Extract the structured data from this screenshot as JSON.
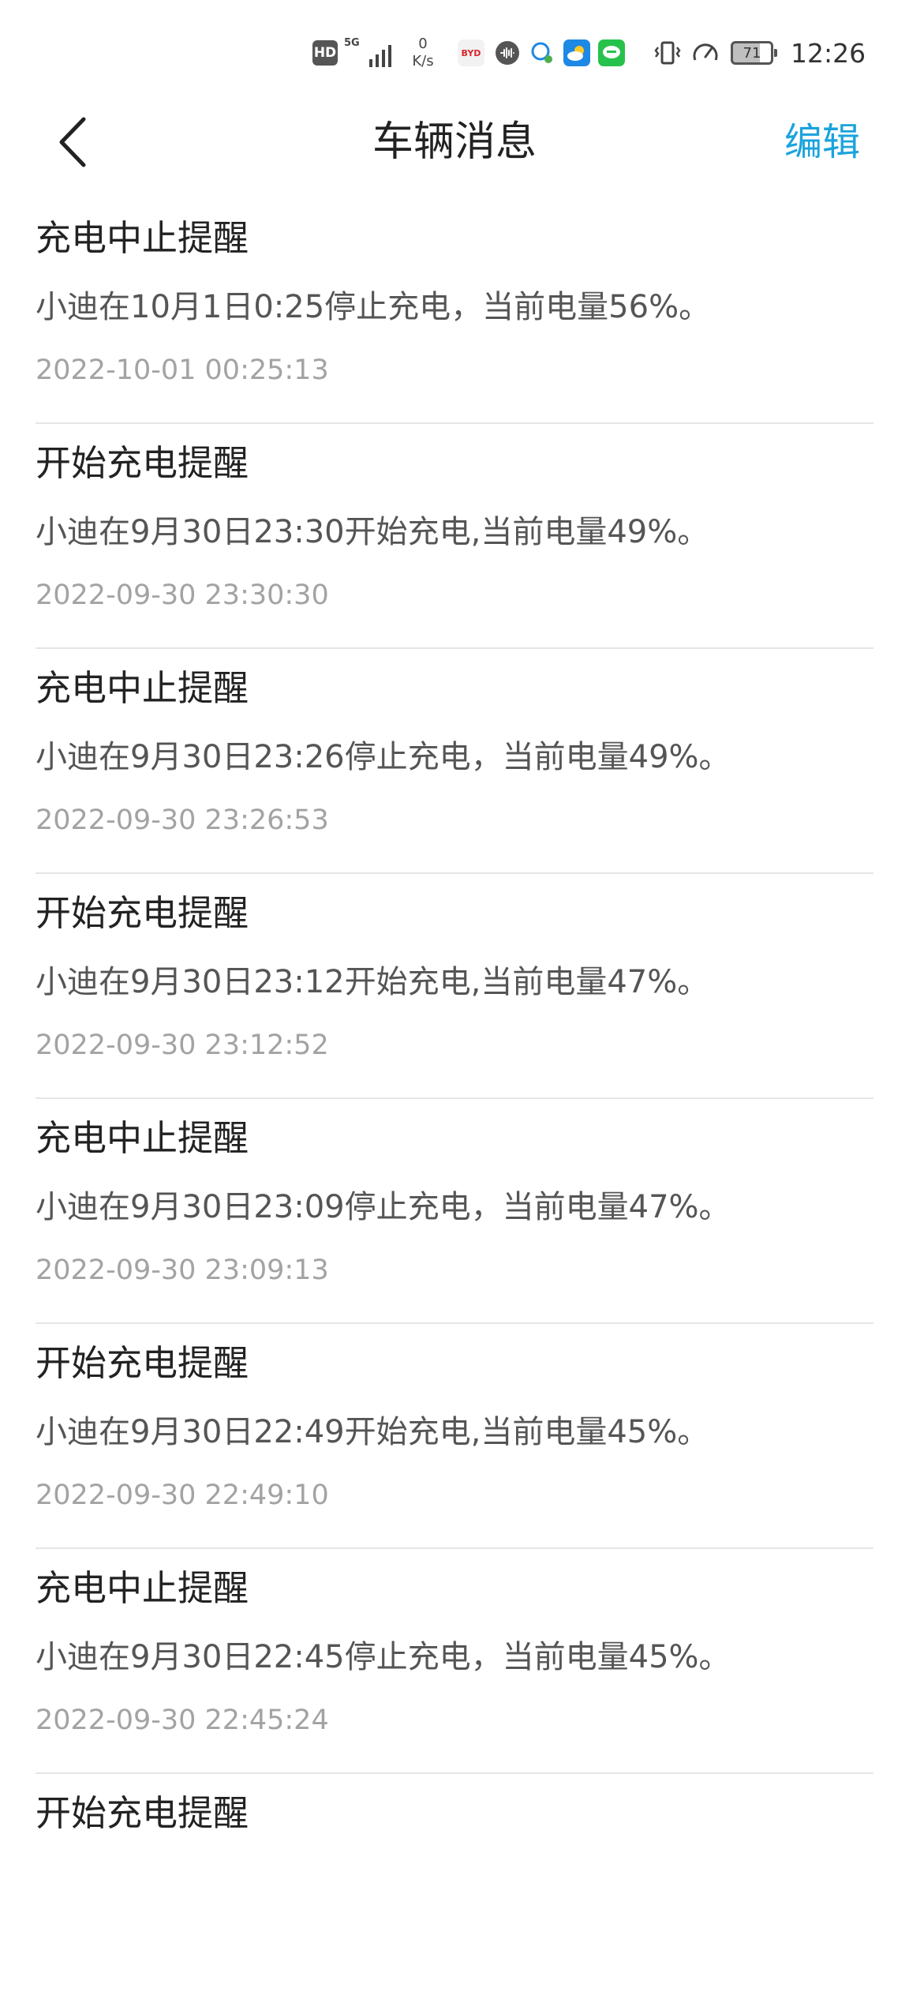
{
  "status_bar": {
    "hd": "HD",
    "network": "5G",
    "net_speed_value": "0",
    "net_speed_unit": "K/s",
    "byd_label": "BYD",
    "battery": "71",
    "battery_level": 0.71,
    "time": "12:26"
  },
  "header": {
    "title": "车辆消息",
    "edit_label": "编辑"
  },
  "messages": [
    {
      "title": "充电中止提醒",
      "body": "小迪在10月1日0:25停止充电，当前电量56%。",
      "time": "2022-10-01 00:25:13"
    },
    {
      "title": "开始充电提醒",
      "body": "小迪在9月30日23:30开始充电,当前电量49%。",
      "time": "2022-09-30 23:30:30"
    },
    {
      "title": "充电中止提醒",
      "body": "小迪在9月30日23:26停止充电，当前电量49%。",
      "time": "2022-09-30 23:26:53"
    },
    {
      "title": "开始充电提醒",
      "body": "小迪在9月30日23:12开始充电,当前电量47%。",
      "time": "2022-09-30 23:12:52"
    },
    {
      "title": "充电中止提醒",
      "body": "小迪在9月30日23:09停止充电，当前电量47%。",
      "time": "2022-09-30 23:09:13"
    },
    {
      "title": "开始充电提醒",
      "body": "小迪在9月30日22:49开始充电,当前电量45%。",
      "time": "2022-09-30 22:49:10"
    },
    {
      "title": "充电中止提醒",
      "body": "小迪在9月30日22:45停止充电，当前电量45%。",
      "time": "2022-09-30 22:45:24"
    },
    {
      "title": "开始充电提醒",
      "body": "",
      "time": ""
    }
  ],
  "colors": {
    "accent": "#1aa3dd",
    "divider": "#e6e6e6",
    "timestamp": "#a3a3a3",
    "body_text": "#555555"
  }
}
